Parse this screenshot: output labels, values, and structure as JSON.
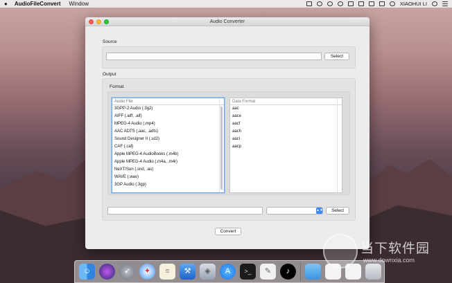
{
  "menubar": {
    "apple": "",
    "app_name": "AudioFileConvert",
    "menus": [
      "Window"
    ],
    "user": "XIAOHUI LI"
  },
  "window": {
    "title": "Audio Converter",
    "source": {
      "label": "Source",
      "path_value": "",
      "select_label": "Select"
    },
    "output": {
      "label": "Output",
      "format_label": "Format",
      "audio_file_header": "Audio File",
      "audio_files": [
        "3GPP-2 Audio (.3g2)",
        "AIFF (.aiff, .aif)",
        "MPEG-4 Audio (.mp4)",
        "AAC ADTS (.aac, .adts)",
        "Sound Designer II (.sd2)",
        "CAF (.caf)",
        "Apple MPEG-4 AudioBooks (.m4b)",
        "Apple MPEG-4 Audio (.m4a, .m4r)",
        "NeXT/Sun (.snd, .au)",
        "WAVE (.wav)",
        "3GP Audio (.3gp)"
      ],
      "data_format_header": "Data Format",
      "data_formats": [
        "aac",
        "aace",
        "aacf",
        "aach",
        "aacl",
        "aacp"
      ],
      "dest_path_value": "",
      "dest_select_label": "Select"
    },
    "convert_label": "Convert"
  },
  "dock": {
    "apps": [
      "finder-icon",
      "siri-icon",
      "launchpad-icon",
      "safari-icon",
      "notes-icon",
      "xcode-icon",
      "package-icon",
      "app-store-icon",
      "terminal-icon",
      "script-editor-icon",
      "itunes-icon",
      "folder-icon",
      "file-icon",
      "file-icon",
      "trash-icon"
    ]
  },
  "watermark": {
    "cn_text": "当下软件园",
    "url": "www.downxia.com"
  },
  "colors": {
    "focus_blue": "#6fa3e6",
    "select_blue": "#3b8af5"
  }
}
